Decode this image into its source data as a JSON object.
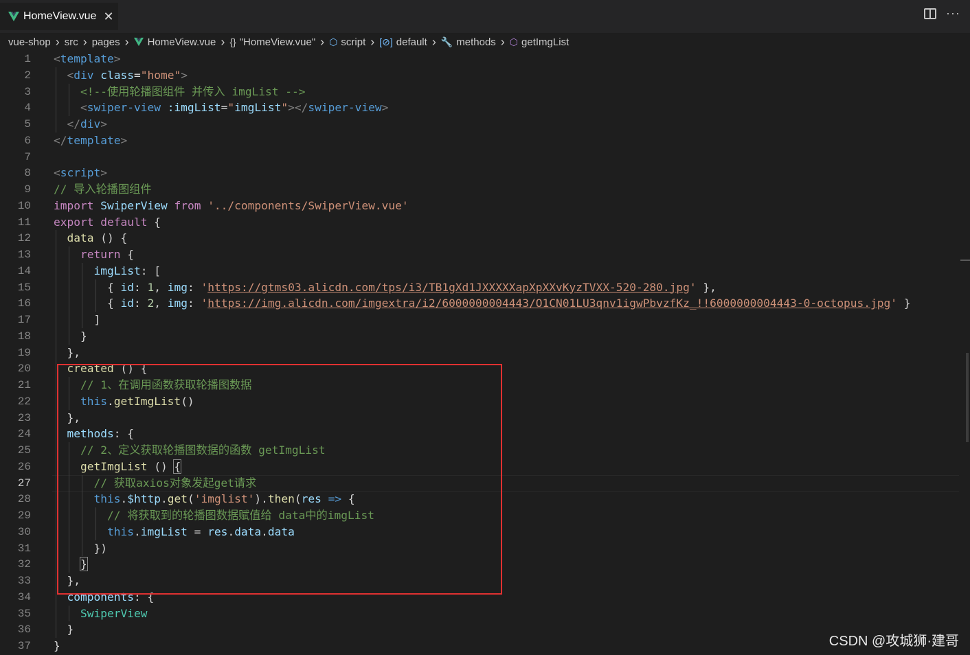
{
  "tab": {
    "title": "HomeView.vue",
    "close": "✕",
    "icon": "vue-icon"
  },
  "tab_actions": {
    "split": "split-editor-icon",
    "more": "···"
  },
  "breadcrumb": [
    {
      "label": "vue-shop",
      "icon": ""
    },
    {
      "label": "src",
      "icon": ""
    },
    {
      "label": "pages",
      "icon": ""
    },
    {
      "label": "HomeView.vue",
      "icon": "vue-icon"
    },
    {
      "label": "\"HomeView.vue\"",
      "icon": "braces-icon",
      "glyph": "{}"
    },
    {
      "label": "script",
      "icon": "cube-icon",
      "glyph": "⬡"
    },
    {
      "label": "default",
      "icon": "variable-icon",
      "glyph": "[⊘]"
    },
    {
      "label": "methods",
      "icon": "wrench-icon",
      "glyph": "🔧"
    },
    {
      "label": "getImgList",
      "icon": "method-icon",
      "glyph": "⬡"
    }
  ],
  "active_line": 27,
  "lines": [
    {
      "n": "1",
      "tokens": [
        [
          "punc",
          "<"
        ],
        [
          "tag",
          "template"
        ],
        [
          "punc",
          ">"
        ]
      ]
    },
    {
      "n": "2",
      "tokens": [
        [
          "plain",
          "  "
        ],
        [
          "punc",
          "<"
        ],
        [
          "tag",
          "div"
        ],
        [
          "plain",
          " "
        ],
        [
          "attr",
          "class"
        ],
        [
          "plain",
          "="
        ],
        [
          "str",
          "\"home\""
        ],
        [
          "punc",
          ">"
        ]
      ]
    },
    {
      "n": "3",
      "tokens": [
        [
          "plain",
          "    "
        ],
        [
          "comment",
          "<!--使用轮播图组件 并传入 imgList -->"
        ]
      ]
    },
    {
      "n": "4",
      "tokens": [
        [
          "plain",
          "    "
        ],
        [
          "punc",
          "<"
        ],
        [
          "tag",
          "swiper-view"
        ],
        [
          "plain",
          " "
        ],
        [
          "attr",
          ":imgList"
        ],
        [
          "plain",
          "="
        ],
        [
          "str",
          "\""
        ],
        [
          "var",
          "imgList"
        ],
        [
          "str",
          "\""
        ],
        [
          "punc",
          "></"
        ],
        [
          "tag",
          "swiper-view"
        ],
        [
          "punc",
          ">"
        ]
      ]
    },
    {
      "n": "5",
      "tokens": [
        [
          "plain",
          "  "
        ],
        [
          "punc",
          "</"
        ],
        [
          "tag",
          "div"
        ],
        [
          "punc",
          ">"
        ]
      ]
    },
    {
      "n": "6",
      "tokens": [
        [
          "punc",
          "</"
        ],
        [
          "tag",
          "template"
        ],
        [
          "punc",
          ">"
        ]
      ]
    },
    {
      "n": "7",
      "tokens": []
    },
    {
      "n": "8",
      "tokens": [
        [
          "punc",
          "<"
        ],
        [
          "tag",
          "script"
        ],
        [
          "punc",
          ">"
        ]
      ]
    },
    {
      "n": "9",
      "tokens": [
        [
          "comment",
          "// 导入轮播图组件"
        ]
      ]
    },
    {
      "n": "10",
      "tokens": [
        [
          "kw",
          "import"
        ],
        [
          "plain",
          " "
        ],
        [
          "var",
          "SwiperView"
        ],
        [
          "plain",
          " "
        ],
        [
          "kw",
          "from"
        ],
        [
          "plain",
          " "
        ],
        [
          "str",
          "'../components/SwiperView.vue'"
        ]
      ]
    },
    {
      "n": "11",
      "tokens": [
        [
          "kw",
          "export"
        ],
        [
          "plain",
          " "
        ],
        [
          "kw",
          "default"
        ],
        [
          "plain",
          " {"
        ]
      ]
    },
    {
      "n": "12",
      "tokens": [
        [
          "plain",
          "  "
        ],
        [
          "fn",
          "data"
        ],
        [
          "plain",
          " () {"
        ]
      ]
    },
    {
      "n": "13",
      "tokens": [
        [
          "plain",
          "    "
        ],
        [
          "kw",
          "return"
        ],
        [
          "plain",
          " {"
        ]
      ]
    },
    {
      "n": "14",
      "tokens": [
        [
          "plain",
          "      "
        ],
        [
          "key",
          "imgList"
        ],
        [
          "plain",
          ": ["
        ]
      ]
    },
    {
      "n": "15",
      "tokens": [
        [
          "plain",
          "        { "
        ],
        [
          "key",
          "id"
        ],
        [
          "plain",
          ": "
        ],
        [
          "num",
          "1"
        ],
        [
          "plain",
          ", "
        ],
        [
          "key",
          "img"
        ],
        [
          "plain",
          ": "
        ],
        [
          "str",
          "'"
        ],
        [
          "link",
          "https://gtms03.alicdn.com/tps/i3/TB1gXd1JXXXXXapXpXXvKyzTVXX-520-280.jpg"
        ],
        [
          "str",
          "'"
        ],
        [
          "plain",
          " },"
        ]
      ]
    },
    {
      "n": "16",
      "tokens": [
        [
          "plain",
          "        { "
        ],
        [
          "key",
          "id"
        ],
        [
          "plain",
          ": "
        ],
        [
          "num",
          "2"
        ],
        [
          "plain",
          ", "
        ],
        [
          "key",
          "img"
        ],
        [
          "plain",
          ": "
        ],
        [
          "str",
          "'"
        ],
        [
          "link",
          "https://img.alicdn.com/imgextra/i2/6000000004443/O1CN01LU3qnv1igwPbvzfKz_!!6000000004443-0-octopus.jpg"
        ],
        [
          "str",
          "'"
        ],
        [
          "plain",
          " }"
        ]
      ]
    },
    {
      "n": "17",
      "tokens": [
        [
          "plain",
          "      ]"
        ]
      ]
    },
    {
      "n": "18",
      "tokens": [
        [
          "plain",
          "    }"
        ]
      ]
    },
    {
      "n": "19",
      "tokens": [
        [
          "plain",
          "  },"
        ]
      ]
    },
    {
      "n": "20",
      "tokens": [
        [
          "plain",
          "  "
        ],
        [
          "fn",
          "created"
        ],
        [
          "plain",
          " () {"
        ]
      ]
    },
    {
      "n": "21",
      "tokens": [
        [
          "plain",
          "    "
        ],
        [
          "comment",
          "// 1、在调用函数获取轮播图数据"
        ]
      ]
    },
    {
      "n": "22",
      "tokens": [
        [
          "plain",
          "    "
        ],
        [
          "blue",
          "this"
        ],
        [
          "plain",
          "."
        ],
        [
          "fn",
          "getImgList"
        ],
        [
          "plain",
          "()"
        ]
      ]
    },
    {
      "n": "23",
      "tokens": [
        [
          "plain",
          "  },"
        ]
      ]
    },
    {
      "n": "24",
      "tokens": [
        [
          "plain",
          "  "
        ],
        [
          "key",
          "methods"
        ],
        [
          "plain",
          ": {"
        ]
      ]
    },
    {
      "n": "25",
      "tokens": [
        [
          "plain",
          "    "
        ],
        [
          "comment",
          "// 2、定义获取轮播图数据的函数 getImgList"
        ]
      ]
    },
    {
      "n": "26",
      "tokens": [
        [
          "plain",
          "    "
        ],
        [
          "fn",
          "getImgList"
        ],
        [
          "plain",
          " () "
        ],
        [
          "box",
          "{"
        ]
      ]
    },
    {
      "n": "27",
      "tokens": [
        [
          "plain",
          "      "
        ],
        [
          "comment",
          "// 获取axios对象发起get请求"
        ]
      ]
    },
    {
      "n": "28",
      "tokens": [
        [
          "plain",
          "      "
        ],
        [
          "blue",
          "this"
        ],
        [
          "plain",
          "."
        ],
        [
          "var",
          "$http"
        ],
        [
          "plain",
          "."
        ],
        [
          "fn",
          "get"
        ],
        [
          "plain",
          "("
        ],
        [
          "str",
          "'imglist'"
        ],
        [
          "plain",
          ")."
        ],
        [
          "fn",
          "then"
        ],
        [
          "plain",
          "("
        ],
        [
          "var",
          "res"
        ],
        [
          "plain",
          " "
        ],
        [
          "blue",
          "=>"
        ],
        [
          "plain",
          " {"
        ]
      ]
    },
    {
      "n": "29",
      "tokens": [
        [
          "plain",
          "        "
        ],
        [
          "comment",
          "// 将获取到的轮播图数据赋值给 data中的imgList"
        ]
      ]
    },
    {
      "n": "30",
      "tokens": [
        [
          "plain",
          "        "
        ],
        [
          "blue",
          "this"
        ],
        [
          "plain",
          "."
        ],
        [
          "var",
          "imgList"
        ],
        [
          "plain",
          " = "
        ],
        [
          "var",
          "res"
        ],
        [
          "plain",
          "."
        ],
        [
          "var",
          "data"
        ],
        [
          "plain",
          "."
        ],
        [
          "var",
          "data"
        ]
      ]
    },
    {
      "n": "31",
      "tokens": [
        [
          "plain",
          "      })"
        ]
      ]
    },
    {
      "n": "32",
      "tokens": [
        [
          "plain",
          "    "
        ],
        [
          "box",
          "}"
        ]
      ]
    },
    {
      "n": "33",
      "tokens": [
        [
          "plain",
          "  },"
        ]
      ]
    },
    {
      "n": "34",
      "tokens": [
        [
          "plain",
          "  "
        ],
        [
          "key",
          "components"
        ],
        [
          "plain",
          ": {"
        ]
      ]
    },
    {
      "n": "35",
      "tokens": [
        [
          "plain",
          "    "
        ],
        [
          "cls",
          "SwiperView"
        ]
      ]
    },
    {
      "n": "36",
      "tokens": [
        [
          "plain",
          "  }"
        ]
      ]
    },
    {
      "n": "37",
      "tokens": [
        [
          "plain",
          "}"
        ]
      ]
    }
  ],
  "watermark": "CSDN @攻城狮·建哥",
  "colors": {
    "background": "#1e1e1e",
    "highlight_box": "#e03131"
  }
}
